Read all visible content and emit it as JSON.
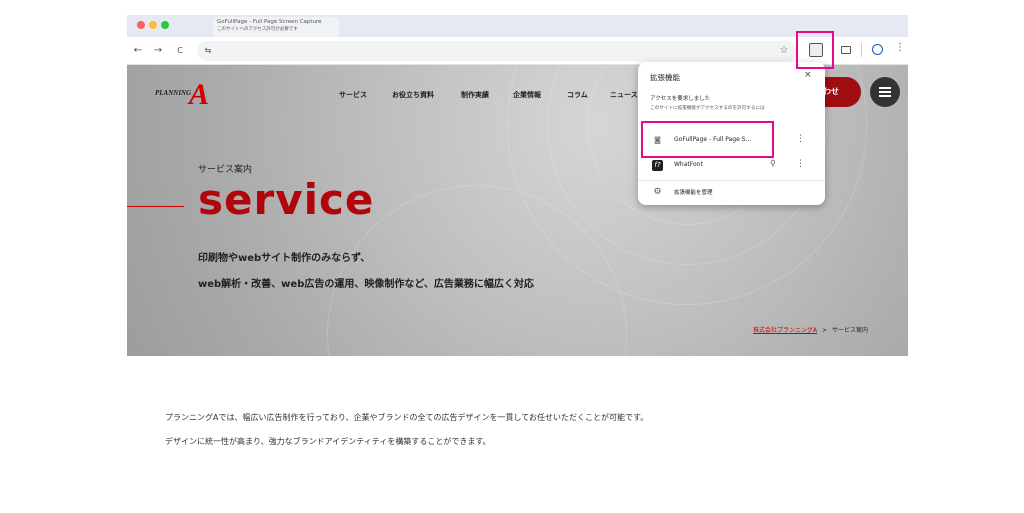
{
  "browser": {
    "tab_title": "GoFullPage - Full Page Screen Capture",
    "tab_subtitle": "このサイトへのアクセス許可が必要です",
    "nav_back": "←",
    "nav_forward": "→",
    "reload": "C",
    "site_settings": "⇆",
    "bookmark_star": "☆"
  },
  "site": {
    "logo_text": "PLANNING",
    "logo_letter": "A",
    "nav": [
      "サービス",
      "お役立ち資料",
      "制作実績",
      "企業情報",
      "コラム",
      "ニュース"
    ],
    "contact_label": "わせ",
    "hero_subtitle": "サービス案内",
    "hero_title": "service",
    "hero_desc_1": "印刷物やwebサイト制作のみならず、",
    "hero_desc_2": "web解析・改善、web広告の運用、映像制作など、広告業務に幅広く対応",
    "breadcrumb_home": "株式会社プランニングA",
    "breadcrumb_sep": ">",
    "breadcrumb_current": "サービス案内",
    "body_para_1": "プランニングAでは、幅広い広告制作を行っており、企業やブランドの全ての広告デザインを一貫してお任せいただくことが可能です。",
    "body_para_2": "デザインに統一性が高まり、強力なブランドアイデンティティを構築することができます。"
  },
  "extensions_popup": {
    "title": "拡張機能",
    "close": "×",
    "request_heading": "アクセスを要求しました",
    "request_note": "このサイトに拡張機能がアクセスするのを許可するには",
    "items": [
      {
        "name": "GoFullPage - Full Page S...",
        "icon": "camera-icon"
      },
      {
        "name": "WhatFont",
        "icon": "whatfont-icon",
        "icon_text": "f?"
      }
    ],
    "manage_label": "拡張機能を管理"
  },
  "colors": {
    "accent_red": "#b0050b",
    "highlight_pink": "#e5098c",
    "hero_gray": "#bdbdbd"
  }
}
